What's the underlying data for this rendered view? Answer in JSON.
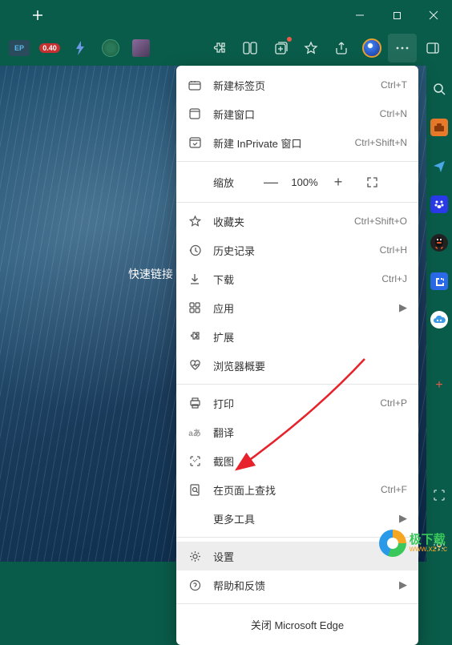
{
  "titlebar": {
    "newtab_glyph": "+"
  },
  "toolbar": {
    "ep_label": "EP",
    "badge": "0.40"
  },
  "content": {
    "quick_links": "快速链接"
  },
  "menu": {
    "new_tab": {
      "label": "新建标签页",
      "shortcut": "Ctrl+T"
    },
    "new_window": {
      "label": "新建窗口",
      "shortcut": "Ctrl+N"
    },
    "new_inprivate": {
      "label": "新建 InPrivate 窗口",
      "shortcut": "Ctrl+Shift+N"
    },
    "zoom": {
      "label": "缩放",
      "minus": "—",
      "percent": "100%",
      "plus": "+"
    },
    "favorites": {
      "label": "收藏夹",
      "shortcut": "Ctrl+Shift+O"
    },
    "history": {
      "label": "历史记录",
      "shortcut": "Ctrl+H"
    },
    "downloads": {
      "label": "下载",
      "shortcut": "Ctrl+J"
    },
    "apps": {
      "label": "应用",
      "submenu": "▶"
    },
    "extensions": {
      "label": "扩展"
    },
    "performance": {
      "label": "浏览器概要"
    },
    "print": {
      "label": "打印",
      "shortcut": "Ctrl+P"
    },
    "translate": {
      "label": "翻译"
    },
    "screenshot": {
      "label": "截图"
    },
    "find": {
      "label": "在页面上查找",
      "shortcut": "Ctrl+F"
    },
    "more_tools": {
      "label": "更多工具",
      "submenu": "▶"
    },
    "settings": {
      "label": "设置"
    },
    "help": {
      "label": "帮助和反馈",
      "submenu": "▶"
    },
    "close": {
      "label": "关闭 Microsoft Edge"
    }
  },
  "watermark": {
    "cn": "极下载",
    "url": "www.xz7.c"
  }
}
